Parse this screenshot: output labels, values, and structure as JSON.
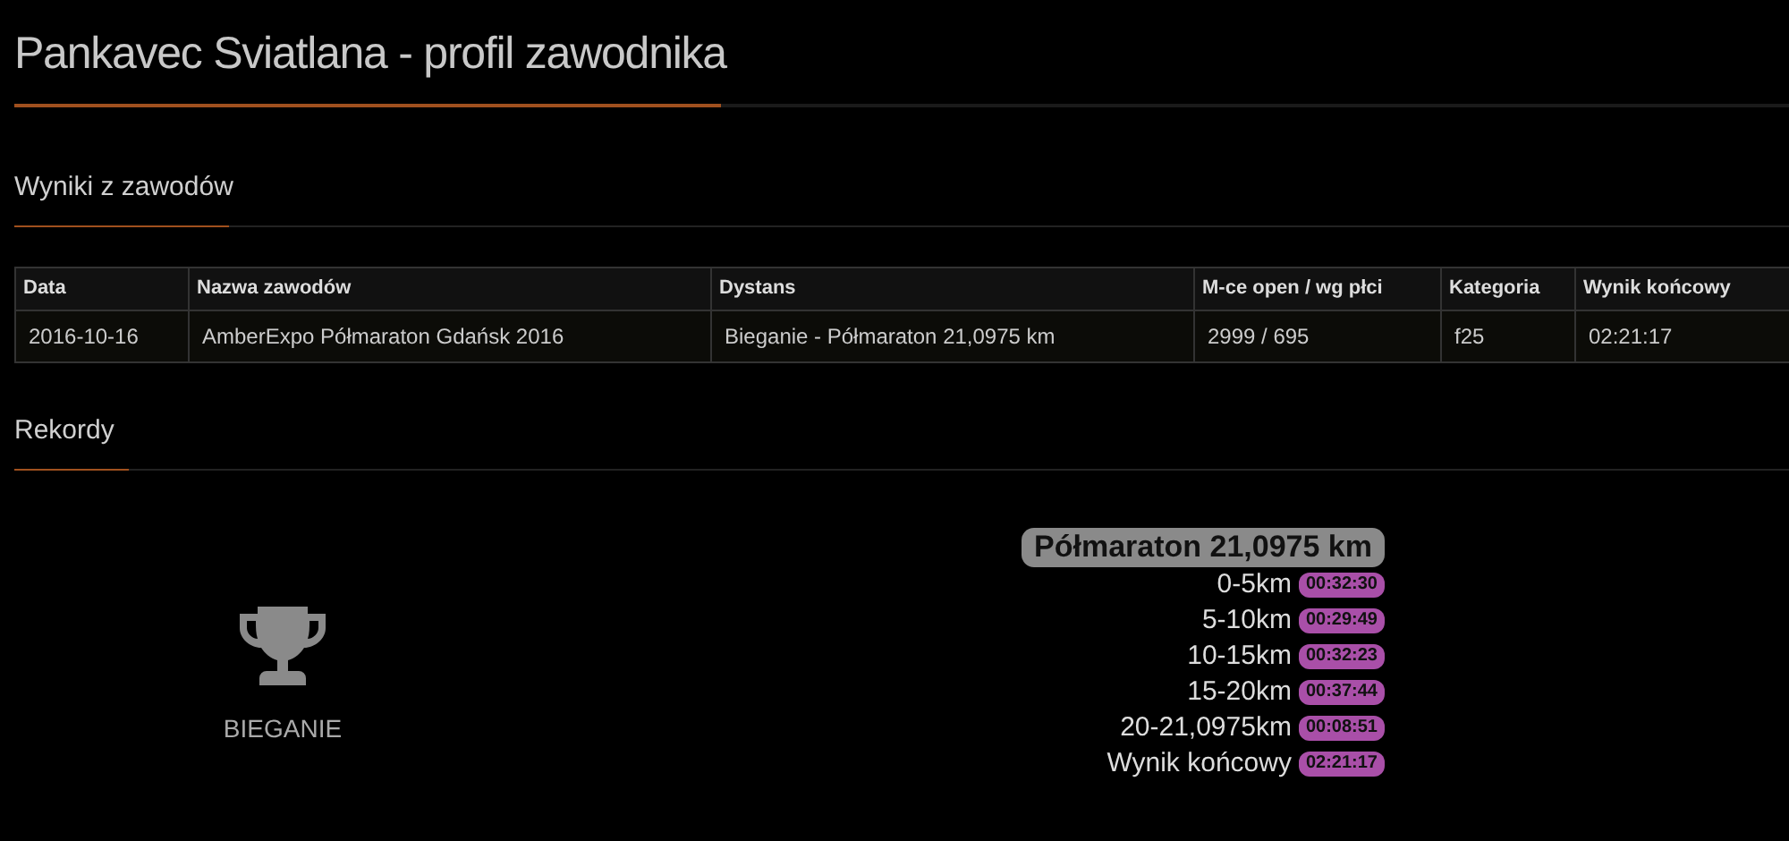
{
  "title": "Pankavec Sviatlana - profil zawodnika",
  "results": {
    "heading": "Wyniki z zawodów",
    "table": {
      "columns": [
        "Data",
        "Nazwa zawodów",
        "Dystans",
        "M-ce open / wg płci",
        "Kategoria",
        "Wynik końcowy"
      ],
      "rows": [
        [
          "2016-10-16",
          "AmberExpo Półmaraton Gdańsk 2016",
          "Bieganie - Półmaraton 21,0975 km",
          "2999 / 695",
          "f25",
          "02:21:17"
        ]
      ]
    }
  },
  "records": {
    "heading": "Rekordy",
    "sport": "BIEGANIE",
    "distance": "Półmaraton 21,0975 km",
    "splits": [
      {
        "label": "0-5km",
        "time": "00:32:30"
      },
      {
        "label": "5-10km",
        "time": "00:29:49"
      },
      {
        "label": "10-15km",
        "time": "00:32:23"
      },
      {
        "label": "15-20km",
        "time": "00:37:44"
      },
      {
        "label": "20-21,0975km",
        "time": "00:08:51"
      },
      {
        "label": "Wynik końcowy",
        "time": "02:21:17"
      }
    ]
  }
}
